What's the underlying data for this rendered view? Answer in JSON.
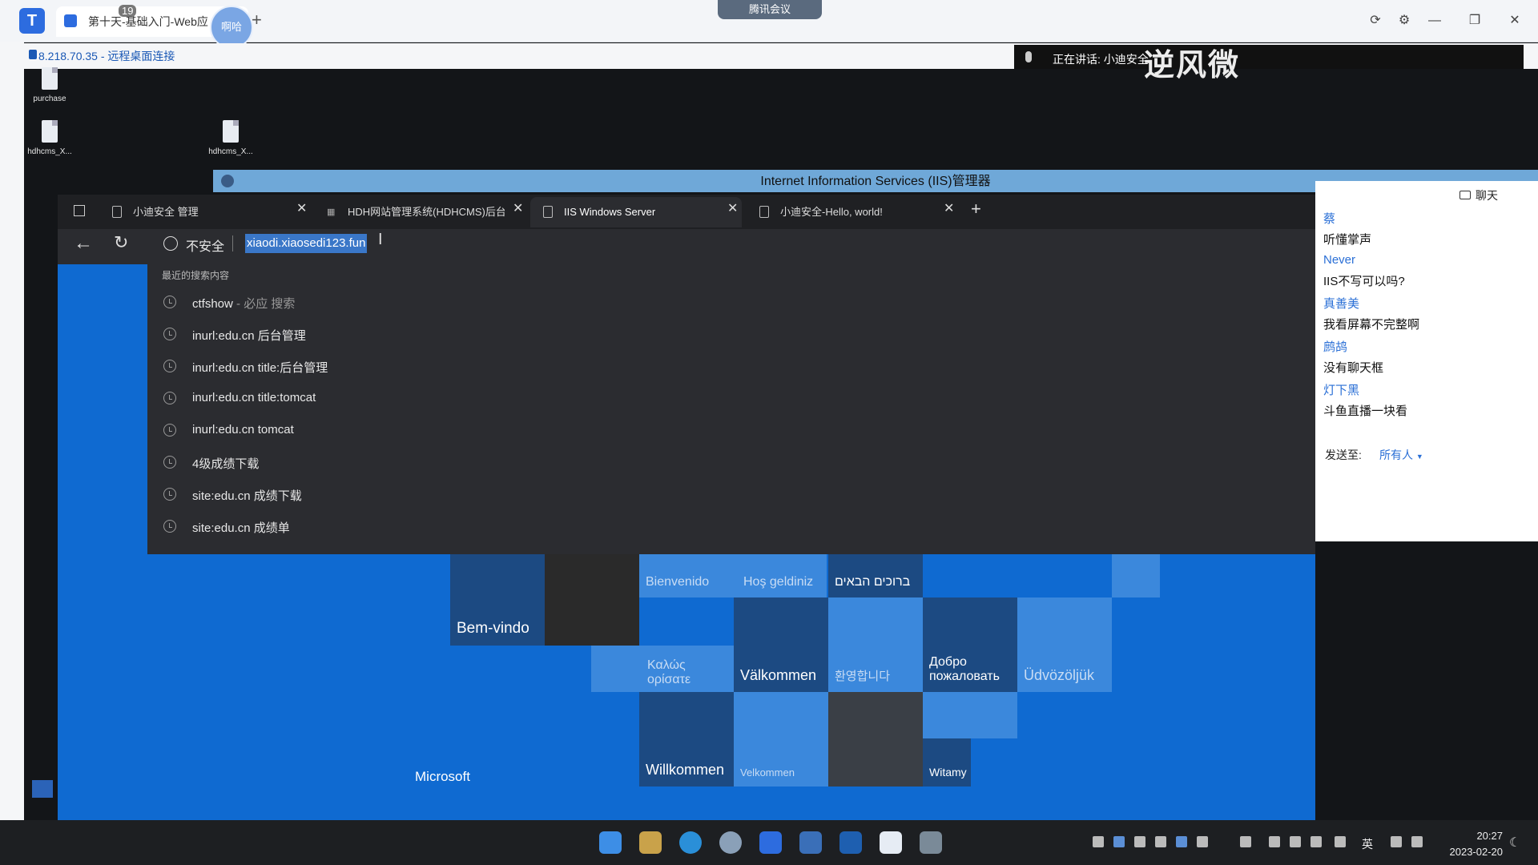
{
  "outer_window": {
    "tab_title": "第十天-基础入门-Web应",
    "avatar_text": "啊哈",
    "meeting_label": "腾讯会议",
    "tab_number": "19"
  },
  "rdp": {
    "connection_text": "8.218.70.35 - 远程桌面连接"
  },
  "speaking": {
    "text": "正在讲话: 小迪安全",
    "watermark": "逆风微"
  },
  "desktop": {
    "icons": [
      {
        "label": "purchase"
      },
      {
        "label": "hdhcms_X..."
      },
      {
        "label": "hdhcms_X..."
      }
    ]
  },
  "iis_window": {
    "title": "Internet Information Services (IIS)管理器"
  },
  "browser": {
    "tabs": [
      {
        "label": "小迪安全 管理"
      },
      {
        "label": "HDH网站管理系统(HDHCMS)后台"
      },
      {
        "label": "IIS Windows Server"
      },
      {
        "label": "小迪安全-Hello, world!"
      }
    ],
    "new_tab_label": "+",
    "not_secure_label": "不安全",
    "url": "xiaodi.xiaosedi123.fun",
    "dropdown_heading": "最近的搜索内容",
    "suggestions": [
      {
        "text": "ctfshow",
        "sub": " - 必应 搜索"
      },
      {
        "text": "inurl:edu.cn 后台管理",
        "sub": ""
      },
      {
        "text": "inurl:edu.cn title:后台管理",
        "sub": ""
      },
      {
        "text": "inurl:edu.cn title:tomcat",
        "sub": ""
      },
      {
        "text": "inurl:edu.cn tomcat",
        "sub": ""
      },
      {
        "text": "4级成绩下载",
        "sub": ""
      },
      {
        "text": "site:edu.cn 成绩下载",
        "sub": ""
      },
      {
        "text": "site:edu.cn 成绩单",
        "sub": ""
      }
    ]
  },
  "iis_page": {
    "tiles": {
      "bem_vindo": "Bem-vindo",
      "bienvenido": "Bienvenido",
      "hos_geldiniz": "Hoş geldiniz",
      "hebrew": "ברוכים הבאים",
      "kalos": "Καλώς ορίσατε",
      "valkommen": "Välkommen",
      "korean": "환영합니다",
      "dobro": "Добро пожаловать",
      "udvozoljuk": "Üdvözöljük",
      "willkommen": "Willkommen",
      "velkommen": "Velkommen",
      "witamy": "Witamy"
    },
    "microsoft_label": "Microsoft"
  },
  "chat": {
    "title": "聊天",
    "messages": [
      {
        "name": "蔡",
        "text": "听懂掌声"
      },
      {
        "name": "Never",
        "text": "IIS不写可以吗?"
      },
      {
        "name": "真善美",
        "text": "我看屏幕不完整啊"
      },
      {
        "name": "鹧鸪",
        "text": "没有聊天框"
      },
      {
        "name": "灯下黑",
        "text": "斗鱼直播一块看"
      }
    ],
    "send_to_label": "发送至:",
    "send_to_value": "所有人"
  },
  "taskbar": {
    "language": "英",
    "time": "20:27",
    "date": "2023-02-20"
  },
  "colors": {
    "iis_blue": "#0f6ad1",
    "browser_dark": "#2b2c30",
    "chat_name_blue": "#2a6fd6"
  }
}
